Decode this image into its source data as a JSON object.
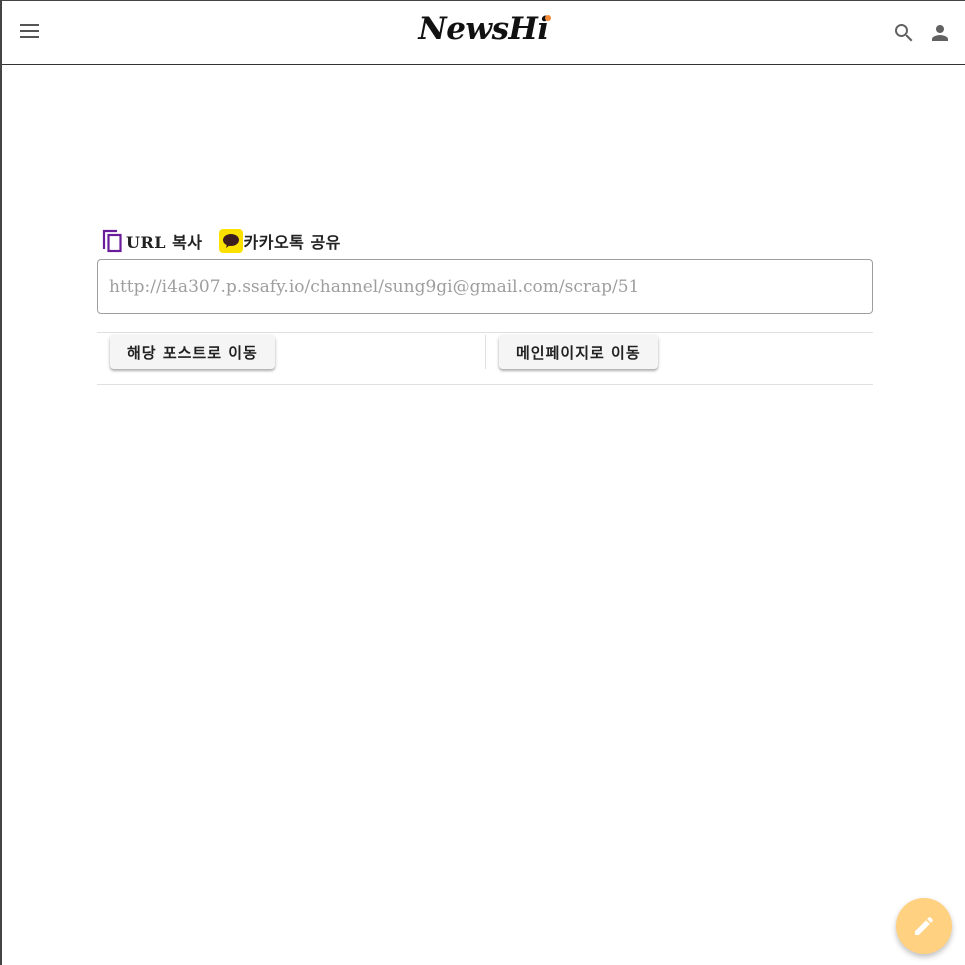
{
  "header": {
    "logo_text": "NewsH",
    "logo_tail": "i",
    "menu_icon": "menu-icon",
    "search_icon": "search-icon",
    "account_icon": "account-icon"
  },
  "share": {
    "copy_label": "URL 복사",
    "copy_icon": "copy-icon",
    "kakao_label": "카카오톡 공유",
    "kakao_icon": "kakao-talk-icon"
  },
  "url_field": {
    "value": "http://i4a307.p.ssafy.io/channel/sung9gi@gmail.com/scrap/51"
  },
  "actions": {
    "go_post_label": "해당 포스트로 이동",
    "go_main_label": "메인페이지로 이동"
  },
  "fab": {
    "icon": "pencil-icon"
  },
  "colors": {
    "accent_purple": "#6a1b9a",
    "kakao_yellow": "#fae100",
    "fab_color": "#ffd180",
    "logo_dot": "#f28c38"
  }
}
